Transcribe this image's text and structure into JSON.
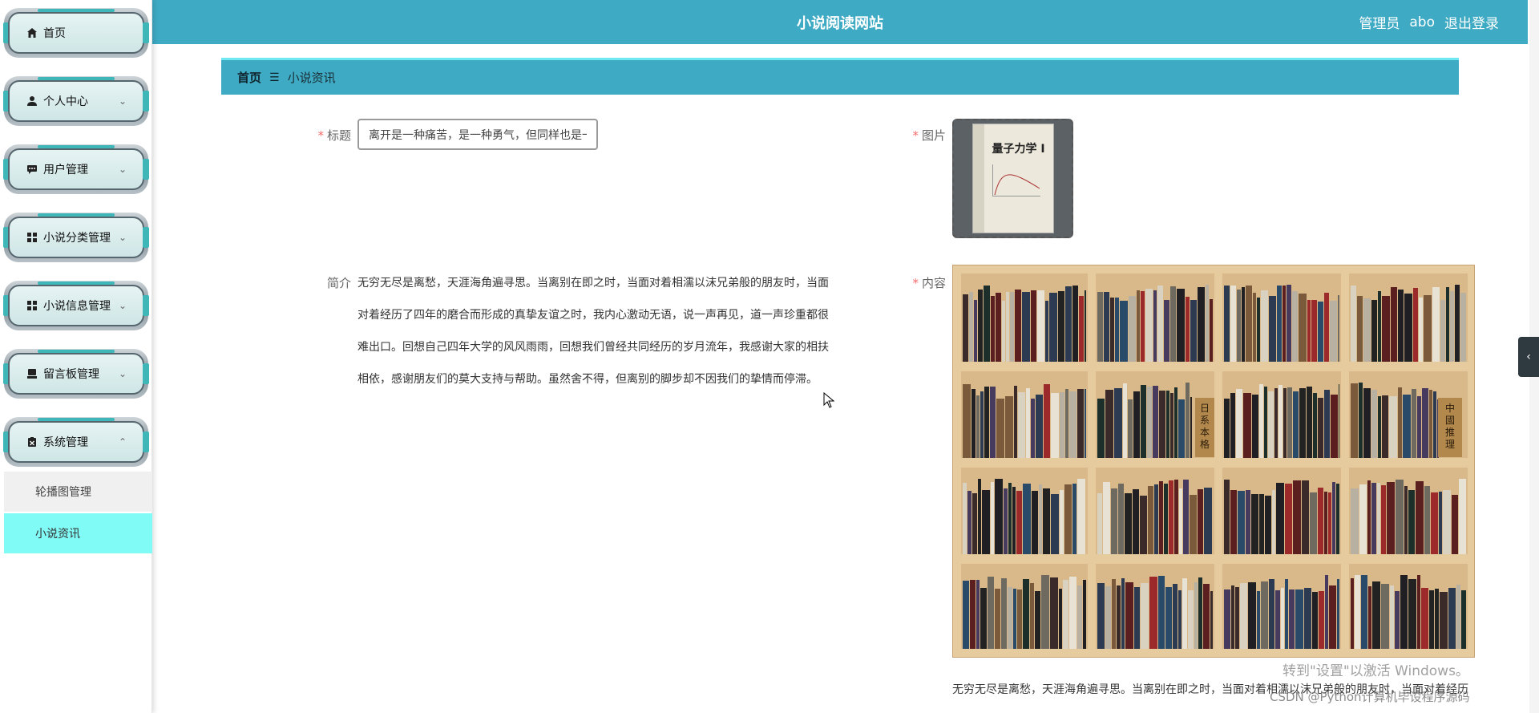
{
  "header": {
    "title": "小说阅读网站",
    "role": "管理员",
    "username": "abo",
    "logout_label": "退出登录"
  },
  "sidebar": {
    "items": [
      {
        "label": "首页",
        "icon": "home-icon",
        "has_chevron": false
      },
      {
        "label": "个人中心",
        "icon": "user-icon",
        "has_chevron": true
      },
      {
        "label": "用户管理",
        "icon": "chat-icon",
        "has_chevron": true
      },
      {
        "label": "小说分类管理",
        "icon": "grid-icon",
        "has_chevron": true
      },
      {
        "label": "小说信息管理",
        "icon": "grid-icon",
        "has_chevron": true
      },
      {
        "label": "留言板管理",
        "icon": "message-board-icon",
        "has_chevron": true
      },
      {
        "label": "系统管理",
        "icon": "clipboard-icon",
        "has_chevron": true
      }
    ],
    "subitems": [
      {
        "label": "轮播图管理",
        "active": false
      },
      {
        "label": "小说资讯",
        "active": true
      }
    ]
  },
  "breadcrumb": {
    "home": "首页",
    "separator": "☰",
    "current": "小说资讯"
  },
  "form": {
    "title_label": "标题",
    "title_value": "离开是一种痛苦，是一种勇气，但同样也是一",
    "image_label": "图片",
    "image_book_title": "量子力学 I",
    "intro_label": "简介",
    "intro_text": "无穷无尽是离愁，天涯海角遍寻思。当离别在即之时，当面对着相濡以沫兄弟般的朋友时，当面对着经历了四年的磨合而形成的真挚友谊之时，我内心激动无语，说一声再见，道一声珍重都很难出口。回想自己四年大学的风风雨雨，回想我们曾经共同经历的岁月流年，我感谢大家的相扶相依，感谢朋友们的莫大支持与帮助。虽然舍不得，但离别的脚步却不因我们的挚情而停滞。",
    "content_label": "内容",
    "content_text": "无穷无尽是离愁，天涯海角遍寻思。当离别在即之时，当面对着相濡以沫兄弟般的朋友时，当面对着经历",
    "bookshelf_signs": [
      "日系本格",
      "中國推理"
    ]
  },
  "watermark": {
    "activate_windows": "转到\"设置\"以激活 Windows。",
    "csdn": "CSDN @Python计算机毕设程序源码"
  },
  "colors": {
    "header_bg": "#3eaac4",
    "active_subitem": "#80fbf6",
    "required_star": "#f56c6c"
  }
}
